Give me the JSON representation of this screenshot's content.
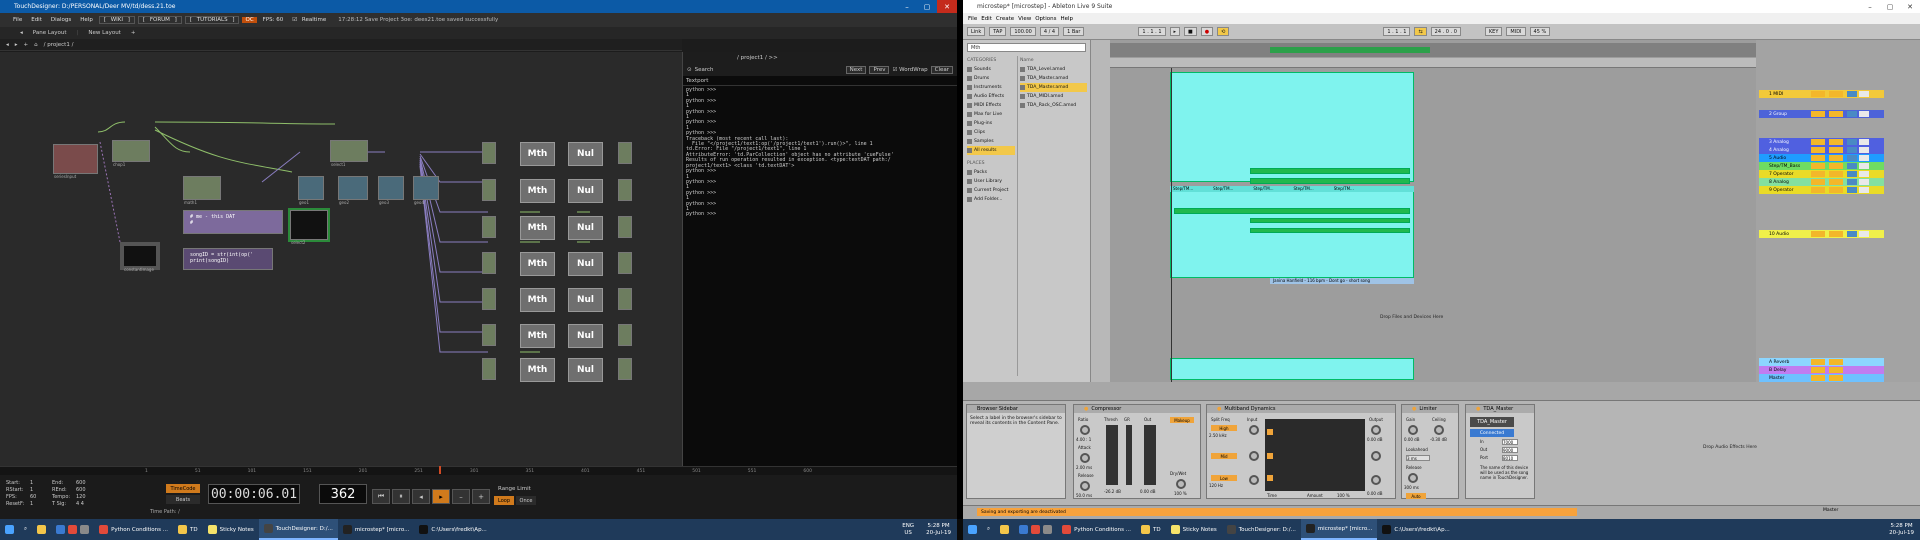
{
  "touchdesigner": {
    "title": "TouchDesigner: D:/PERSONAL/Deer MV/td/dess.21.toe",
    "menu": [
      "File",
      "Edit",
      "Dialogs",
      "Help"
    ],
    "pills": [
      "WIKI",
      "FORUM",
      "TUTORIALS"
    ],
    "oc": "OC",
    "fps": "FPS: 60",
    "realtime": "Realtime",
    "status": "17:28:12 Save Project 3oe: dees21.toe saved successfully",
    "layouts": [
      "Pane Layout",
      "New Layout"
    ],
    "path": "/ project1 /",
    "text_pane": {
      "path": "/ project1 / >>",
      "search_label": "Search",
      "next": "Next",
      "prev": "Prev",
      "wordwrap": "WordWrap",
      "clear": "Clear",
      "tab": "Textport",
      "console": "python >>>\n1\npython >>>\n1\npython >>>\n1\npython >>>\n1\npython >>>\nTraceback (most recent call last):\n  File \"</project1/text1:op('/project1/text1').run()>\", line 1\ntd.Error: File \"/project1/text1\", line 1\nAttributeError: 'td.ParCollection' object has no attribute 'cueFulse'\nResults of run operation resulted in exception. <type:textDAT path:/\nproject1/text1> <class 'td.textDAT'>\npython >>>\n1\npython >>>\n1\npython >>>\n1\npython >>>\n1\npython >>>"
    },
    "nodes": {
      "dat_text": "# me - this DAT\n#",
      "script": "songID = str(int(op('\nprint(songID)",
      "tile_math": "Mth",
      "tile_null": "Nul"
    },
    "stats": [
      {
        "k": "Start:",
        "v": "1",
        "k2": "End:",
        "v2": "600"
      },
      {
        "k": "RStart:",
        "v": "1",
        "k2": "REnd:",
        "v2": "600"
      },
      {
        "k": "FPS:",
        "v": "60",
        "k2": "Tempo:",
        "v2": "120"
      },
      {
        "k": "ResetF:",
        "v": "1",
        "k2": "T Sig:",
        "v2": "4   4"
      }
    ],
    "timecode_label": "TimeCode",
    "beats_label": "Beats",
    "timecode": "00:00:06.01",
    "frame": "362",
    "range_limit": "Range Limit",
    "loop": "Loop",
    "once": "Once",
    "time_path": "Time Path: /",
    "ruler": [
      "1",
      "51",
      "101",
      "151",
      "201",
      "251",
      "301",
      "351",
      "401",
      "451",
      "501",
      "551",
      "600"
    ]
  },
  "ableton": {
    "title": "microstep* [microstep] - Ableton Live 9 Suite",
    "menu": [
      "File",
      "Edit",
      "Create",
      "View",
      "Options",
      "Help"
    ],
    "transport": {
      "link": "Link",
      "tap": "TAP",
      "bpm": "100.00",
      "sig": "4 / 4",
      "bar": "1 Bar",
      "pos": "1 . 1 . 1",
      "loop_pos": "1 . 1 . 1",
      "key": "KEY",
      "midi": "MIDI",
      "zoom": "45 %",
      "len": "24 . 0 . 0"
    },
    "browser": {
      "search": "Mth",
      "categories_header": "CATEGORIES",
      "categories": [
        "Sounds",
        "Drums",
        "Instruments",
        "Audio Effects",
        "MIDI Effects",
        "Max for Live",
        "Plug-ins",
        "Clips",
        "Samples",
        "All results"
      ],
      "places_header": "PLACES",
      "places": [
        "Packs",
        "User Library",
        "Current Project",
        "Add Folder..."
      ],
      "name_header": "Name",
      "files": [
        "TDA_Level.amxd",
        "TDA_Master.amxd",
        "TDA_Master.amxd",
        "TDA_MIDI.amxd",
        "TDA_Rack_OSC.amxd"
      ]
    },
    "arrangement": {
      "song_label": "Janina Hanfield - 116 bpm - Dont go - short song",
      "drop_hint": "Drop Files and Devices Here",
      "clip_labels": [
        "Step/TM...",
        "Step/TM...",
        "Step/TM...",
        "Step/TM...",
        "Step/TM..."
      ]
    },
    "tracks": [
      {
        "name": "1 MIDI",
        "color": "#f2c93a"
      },
      {
        "name": "2 Group",
        "color": "#f2a024"
      },
      {
        "name": "3 Analog",
        "color": "#c8c8ff"
      },
      {
        "name": "4 Analog",
        "color": "#b0b0ff"
      },
      {
        "name": "5 Audio",
        "color": "#1f9cff"
      },
      {
        "name": "Step/TM_Bass",
        "color": "#6fdc62"
      },
      {
        "name": "7 Operator",
        "color": "#eadb27"
      },
      {
        "name": "8 Analog",
        "color": "#84e0a0"
      },
      {
        "name": "9 Operator",
        "color": "#eadb27"
      },
      {
        "name": "10 Audio",
        "color": "#f0f04a"
      },
      {
        "name": "A Reverb",
        "color": "#8cd6ff"
      },
      {
        "name": "B Delay",
        "color": "#c07cf0"
      },
      {
        "name": "Master",
        "color": "#6ec1ff"
      }
    ],
    "devices": {
      "browser_sidebar": {
        "title": "Browser Sidebar",
        "text": "Select a label in the browser's sidebar to reveal its contents in the Content Pane."
      },
      "compressor": {
        "title": "Compressor",
        "labels": [
          "Ratio",
          "Attack",
          "Release",
          "Thresh",
          "GR",
          "Out",
          "Makeup",
          "Dry/Wet"
        ],
        "values": [
          "4.00 : 1",
          "2.00 ms",
          "50.0 ms",
          "-26.2 dB",
          "0.00 dB",
          "100 %"
        ]
      },
      "multiband": {
        "title": "Multiband Dynamics",
        "labels": [
          "Split Freq",
          "Input",
          "High",
          "Mid",
          "Low",
          "Output",
          "Time",
          "Amount"
        ],
        "values": [
          "2.50 kHz",
          "0.00 dB",
          "120 Hz",
          "0.00 dB",
          "100 %"
        ]
      },
      "limiter": {
        "title": "Limiter",
        "labels": [
          "Gain",
          "Ceiling",
          "Lookahead",
          "Release",
          "Auto"
        ],
        "values": [
          "0.00 dB",
          "-0.30 dB",
          "3 ms",
          "300 ms"
        ]
      },
      "tda_master": {
        "title": "TDA_Master",
        "connected": "Connected",
        "port_labels": [
          "In",
          "Out",
          "Port"
        ],
        "ports": [
          "7000",
          "9000",
          "8010"
        ],
        "text": "The name of this device will be used as the song name in TouchDesigner."
      },
      "drop_effects": "Drop Audio Effects Here"
    },
    "status_warning": "Saving and exporting are deactivated",
    "footer_track": "Master"
  },
  "taskbar": {
    "apps": [
      "Python Conditions ...",
      "TD",
      "Sticky Notes",
      "TouchDesigner: D:/...",
      "microstep* [micro...",
      "C:\\Users\\fredkt\\Ap..."
    ],
    "lang": "ENG\nUS",
    "time": "5:28 PM",
    "date": "20-Jul-19"
  }
}
